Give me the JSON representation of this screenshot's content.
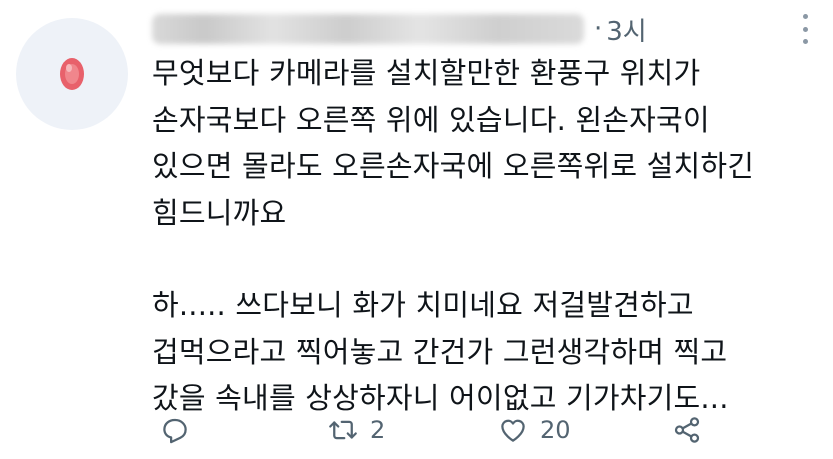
{
  "header": {
    "time": "3시",
    "separator": "·"
  },
  "tweet": {
    "lines": [
      "무엇보다 카메라를 설치할만한 환풍구 위치가",
      "손자국보다 오른쪽 위에 있습니다. 왼손자국이",
      "있으면 몰라도 오른손자국에 오른쪽위로 설치하긴",
      "힘드니까요",
      "",
      "하..... 쓰다보니 화가 치미네요 저걸발견하고",
      "겁먹으라고 찍어놓고 간건가 그런생각하며 찍고",
      "갔을 속내를 상상하자니 어이없고 기가차기도..."
    ]
  },
  "actions": {
    "reply_icon": "reply-icon",
    "retweet_icon": "retweet-icon",
    "retweet_count": "2",
    "like_icon": "heart-icon",
    "like_count": "20",
    "share_icon": "share-icon"
  },
  "colors": {
    "text": "#0f1419",
    "muted": "#536471",
    "avatar_bg": "#eef2f8",
    "avatar_gem": "#e8616b"
  }
}
